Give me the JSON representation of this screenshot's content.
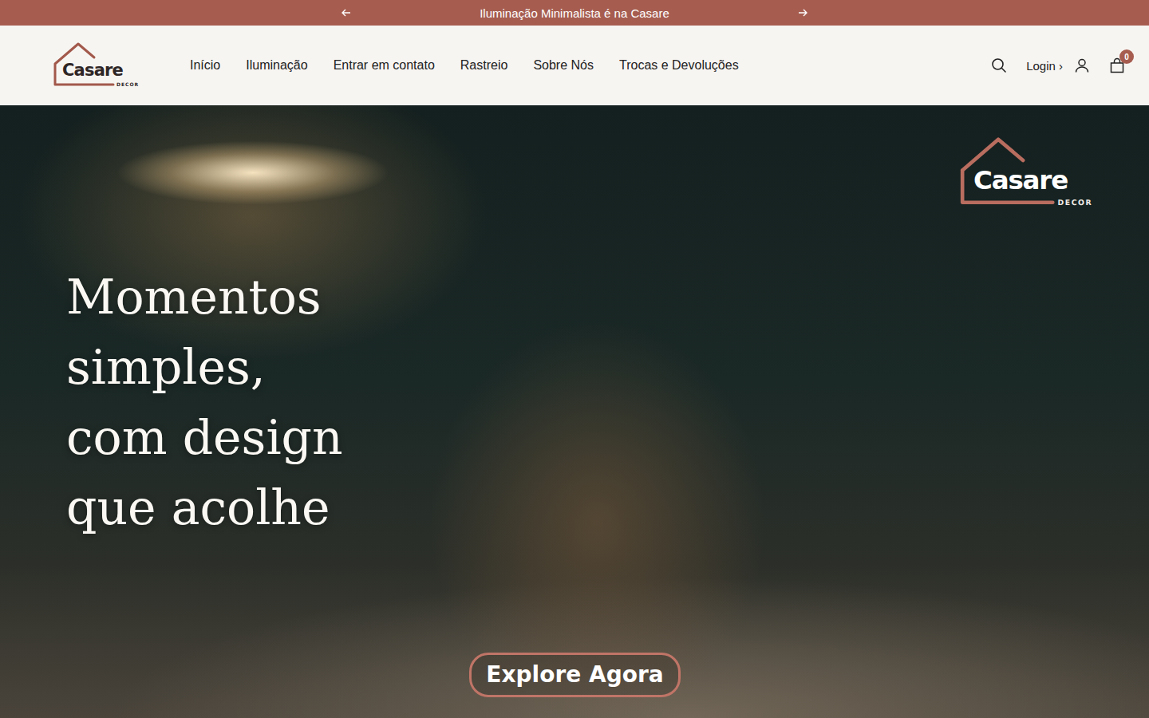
{
  "announcement": {
    "text": "Iluminação Minimalista é na Casare"
  },
  "header": {
    "logo": {
      "name": "Casare",
      "tagline": "DECOR"
    },
    "nav": [
      "Início",
      "Iluminação",
      "Entrar em contato",
      "Rastreio",
      "Sobre Nós",
      "Trocas e Devoluções"
    ],
    "login": "Login ›",
    "cart": {
      "count": "0"
    }
  },
  "hero": {
    "logo": {
      "name": "Casare",
      "tagline": "DECOR"
    },
    "headline": [
      "Momentos",
      "simples,",
      "com design",
      "que acolhe"
    ],
    "button": "Explore Agora"
  }
}
